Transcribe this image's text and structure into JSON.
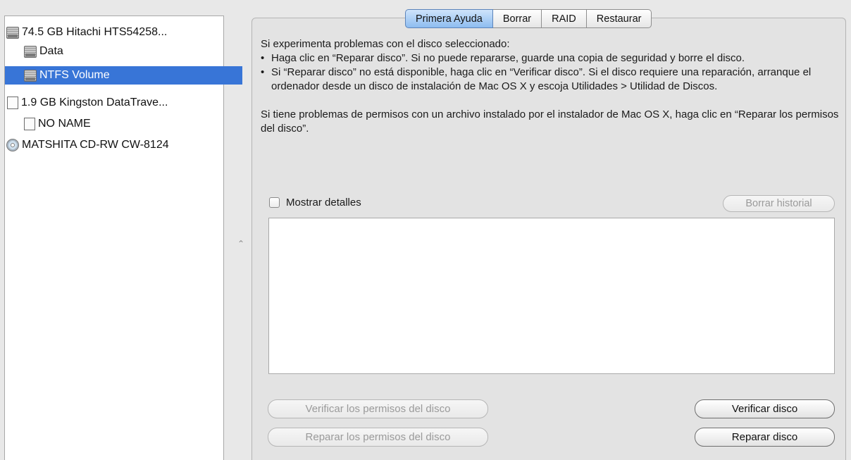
{
  "sidebar": {
    "items": [
      {
        "label": "74.5 GB Hitachi HTS54258...",
        "icon": "hard-disk-icon"
      },
      {
        "label": "Data",
        "icon": "hard-disk-icon"
      },
      {
        "label": "NTFS Volume",
        "icon": "hard-disk-icon",
        "selected": true
      },
      {
        "label": "1.9 GB Kingston DataTrave...",
        "icon": "usb-drive-icon"
      },
      {
        "label": "NO NAME",
        "icon": "usb-drive-icon"
      },
      {
        "label": "MATSHITA CD-RW CW-8124",
        "icon": "optical-disc-icon"
      }
    ]
  },
  "tabs": [
    {
      "label": "Primera Ayuda",
      "active": true
    },
    {
      "label": "Borrar"
    },
    {
      "label": "RAID"
    },
    {
      "label": "Restaurar"
    }
  ],
  "first_aid": {
    "intro": "Si experimenta problemas con el disco seleccionado:",
    "bullet_char": "•",
    "bullets": [
      "Haga clic en “Reparar disco”. Si no puede repararse, guarde una copia de seguridad y borre el disco.",
      "Si “Reparar disco” no está disponible, haga clic en “Verificar disco”. Si el disco requiere una reparación, arranque el ordenador desde un disco de instalación de Mac OS X y escoja Utilidades > Utilidad de Discos."
    ],
    "permissions_text": "Si tiene problemas de permisos con un archivo instalado por el instalador de Mac OS X, haga clic en “Reparar los permisos del disco”.",
    "show_details_label": "Mostrar detalles",
    "show_details_checked": false,
    "clear_history_label": "Borrar historial",
    "verify_permissions_label": "Verificar los permisos del disco",
    "repair_permissions_label": "Reparar los permisos del disco",
    "verify_disk_label": "Verificar disco",
    "repair_disk_label": "Reparar disco"
  },
  "colors": {
    "selection": "#3875d7",
    "active_tab": "#8dbcf0"
  }
}
